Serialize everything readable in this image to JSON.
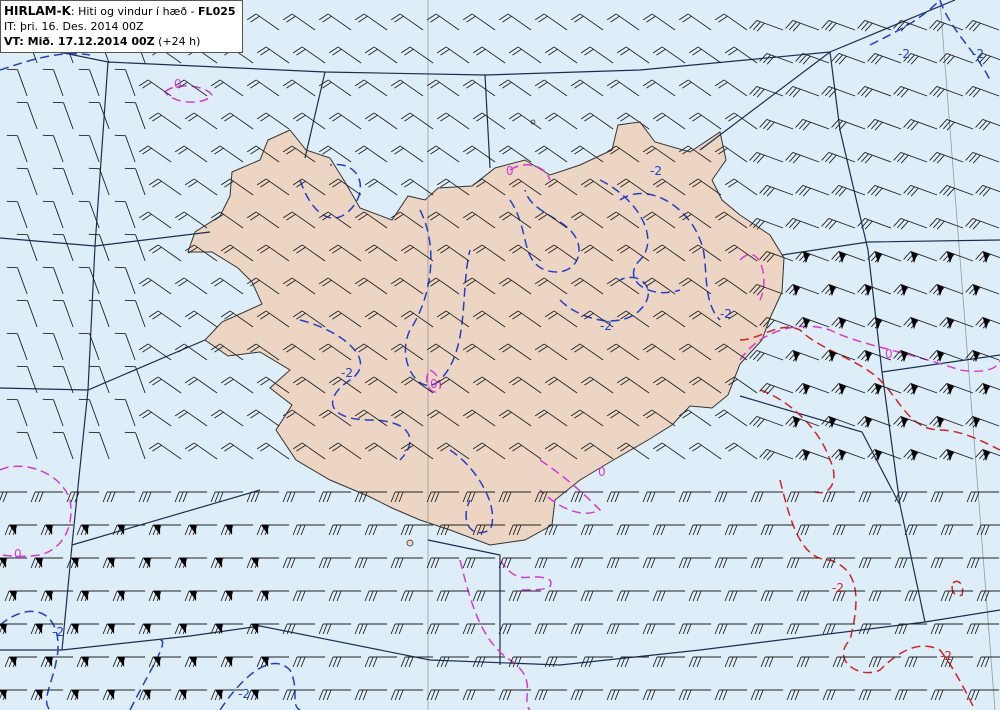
{
  "header": {
    "model": "HIRLAM-K",
    "description": ": Hiti og vindur í hæð - ",
    "level": "FL025",
    "init_label": "IT: ",
    "init_value": "þri. 16. Des. 2014 00Z",
    "valid_label": "VT: Mið. 17.12.2014 00Z",
    "valid_offset": "(+24 h)"
  },
  "contour_labels": [
    {
      "text": "0",
      "color": "#d63ad6"
    },
    {
      "text": "-2",
      "color": "#1f3fcf"
    },
    {
      "text": "-2",
      "color": "#1f3fcf"
    },
    {
      "text": "-2",
      "color": "#1f3fcf"
    },
    {
      "text": "0",
      "color": "#d63ad6"
    },
    {
      "text": "-2",
      "color": "#1f3fcf"
    },
    {
      "text": "0",
      "color": "#d63ad6"
    },
    {
      "text": "0",
      "color": "#d63ad6"
    },
    {
      "text": "0",
      "color": "#d63ad6"
    },
    {
      "text": "-2",
      "color": "#1f3fcf"
    },
    {
      "text": "-2",
      "color": "#1f3fcf"
    },
    {
      "text": "-2",
      "color": "#d62020"
    },
    {
      "text": "-2",
      "color": "#d62020"
    },
    {
      "text": "0",
      "color": "#d63ad6"
    },
    {
      "text": "-2",
      "color": "#1f3fcf"
    },
    {
      "text": "-2",
      "color": "#1f3fcf"
    }
  ],
  "colors": {
    "sea": "#ddeef8",
    "land": "#ecd6c3",
    "coast": "#333333",
    "grid": "#1a2e55",
    "contour_cold": "#1f3fcf",
    "contour_zero": "#d63ad6",
    "contour_warm": "#d62020"
  }
}
